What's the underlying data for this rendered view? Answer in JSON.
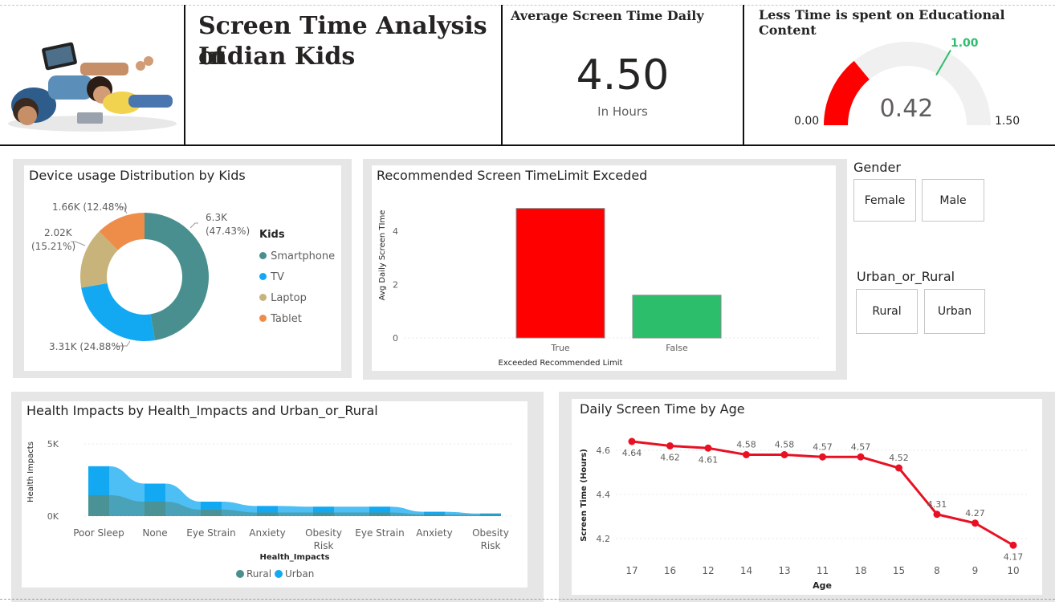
{
  "header": {
    "title_line1": "Screen Time Analysis of",
    "title_line2": "Indian  Kids",
    "kpi": {
      "title": "Average Screen Time Daily",
      "value": "4.50",
      "unit": "In Hours"
    },
    "gauge": {
      "title": "Less Time is spent on Educational Content",
      "value": 0.42,
      "value_label": "0.42",
      "min_label": "0.00",
      "max_label": "1.50",
      "target_label": "1.00",
      "min": 0,
      "max": 1.5,
      "target": 1.0
    }
  },
  "colors": {
    "teal": "#4a8f8f",
    "blue": "#12a9f2",
    "khaki": "#c8b47a",
    "orange": "#ee8d4a",
    "red": "#ff0000",
    "green": "#2dbe6c",
    "line_red": "#e81123"
  },
  "donut": {
    "title": "Device usage Distribution by Kids",
    "legend_title": "Kids",
    "slices": [
      {
        "name": "Smartphone",
        "label": "6.3K",
        "pct": "(47.43%)",
        "share": 47.43
      },
      {
        "name": "TV",
        "label": "3.31K (24.88%)",
        "pct": "",
        "share": 24.88
      },
      {
        "name": "Laptop",
        "label": "2.02K",
        "pct": "(15.21%)",
        "share": 15.21
      },
      {
        "name": "Tablet",
        "label": "1.66K (12.48%)",
        "pct": "",
        "share": 12.48
      }
    ]
  },
  "chart_data": [
    {
      "type": "bar",
      "title": "Recommended Screen TimeLimit Exceded",
      "xlabel": "Exceeded  Recommended  Limit",
      "ylabel": "Avg Daily Screen TIme",
      "categories": [
        "True",
        "False"
      ],
      "values": [
        4.85,
        1.6
      ],
      "yticks": [
        "0",
        "2",
        "4"
      ],
      "ylim": [
        0,
        5.2
      ]
    },
    {
      "type": "area",
      "title": "Health Impacts by Health_Impacts and Urban_or_Rural",
      "xlabel": "Health_Impacts",
      "ylabel": "Health Impacts",
      "categories": [
        "Poor Sleep",
        "None",
        "Eye Strain",
        "Anxiety",
        "Obesity Risk",
        "Eye Strain",
        "Anxiety",
        "Obesity Risk"
      ],
      "yticks": [
        "0K",
        "5K"
      ],
      "ylim": [
        0,
        5000
      ],
      "series": [
        {
          "name": "Rural",
          "values": [
            1450,
            1000,
            450,
            250,
            250,
            250,
            120,
            100
          ]
        },
        {
          "name": "Urban",
          "values": [
            3450,
            2250,
            1000,
            700,
            650,
            650,
            300,
            180
          ]
        }
      ]
    },
    {
      "type": "line",
      "title": "Daily Screen Time by Age",
      "xlabel": "Age",
      "ylabel": "Screen Time (Hours)",
      "x": [
        "17",
        "16",
        "12",
        "14",
        "13",
        "11",
        "18",
        "15",
        "8",
        "9",
        "10"
      ],
      "values": [
        4.64,
        4.62,
        4.61,
        4.58,
        4.58,
        4.57,
        4.57,
        4.52,
        4.31,
        4.27,
        4.17
      ],
      "labels": [
        "4.64",
        "4.62",
        "4.61",
        "4.58",
        "4.58",
        "4.57",
        "4.57",
        "4.52",
        "4.31",
        "4.27",
        "4.17"
      ],
      "yticks": [
        "4.2",
        "4.4",
        "4.6"
      ],
      "ylim": [
        4.15,
        4.67
      ]
    }
  ],
  "slicers": {
    "gender": {
      "title": "Gender",
      "options": [
        "Female",
        "Male"
      ]
    },
    "location": {
      "title": "Urban_or_Rural",
      "options": [
        "Rural",
        "Urban"
      ]
    }
  }
}
